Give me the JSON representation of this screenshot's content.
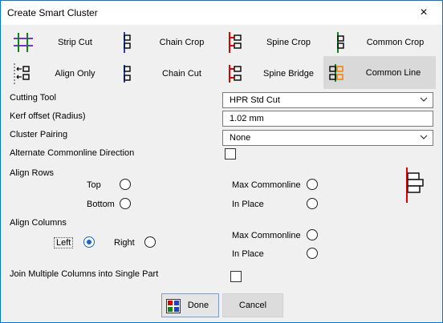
{
  "window": {
    "title": "Create Smart Cluster",
    "close": "×"
  },
  "toolbar": {
    "items": [
      {
        "label": "Strip Cut",
        "icon": "strip-cut-icon"
      },
      {
        "label": "Chain Crop",
        "icon": "chain-crop-icon"
      },
      {
        "label": "Spine Crop",
        "icon": "spine-crop-icon"
      },
      {
        "label": "Common Crop",
        "icon": "common-crop-icon"
      },
      {
        "label": "Align Only",
        "icon": "align-only-icon"
      },
      {
        "label": "Chain Cut",
        "icon": "chain-cut-icon"
      },
      {
        "label": "Spine Bridge",
        "icon": "spine-bridge-icon"
      },
      {
        "label": "Common Line",
        "icon": "common-line-icon",
        "selected": true
      }
    ]
  },
  "form": {
    "cutting_tool_label": "Cutting Tool",
    "cutting_tool_value": "HPR Std Cut",
    "kerf_label": "Kerf offset (Radius)",
    "kerf_value": "1.02 mm",
    "pairing_label": "Cluster Pairing",
    "pairing_value": "None",
    "alt_commonline_label": "Alternate Commonline Direction",
    "alt_commonline_checked": false
  },
  "align_rows": {
    "label": "Align Rows",
    "top": "Top",
    "bottom": "Bottom",
    "max_commonline": "Max Commonline",
    "in_place": "In Place"
  },
  "align_columns": {
    "label": "Align Columns",
    "left": "Left",
    "right": "Right",
    "selected": "Left",
    "max_commonline": "Max Commonline",
    "in_place": "In Place"
  },
  "join_columns": {
    "label": "Join Multiple Columns into Single Part",
    "checked": false
  },
  "buttons": {
    "done": "Done",
    "cancel": "Cancel"
  },
  "colors": {
    "accent": "#0078d7",
    "blue": "#1f3fcf",
    "red": "#e00000",
    "green": "#0a8a0a",
    "orange": "#f08000",
    "purple": "#7a2fd0"
  }
}
